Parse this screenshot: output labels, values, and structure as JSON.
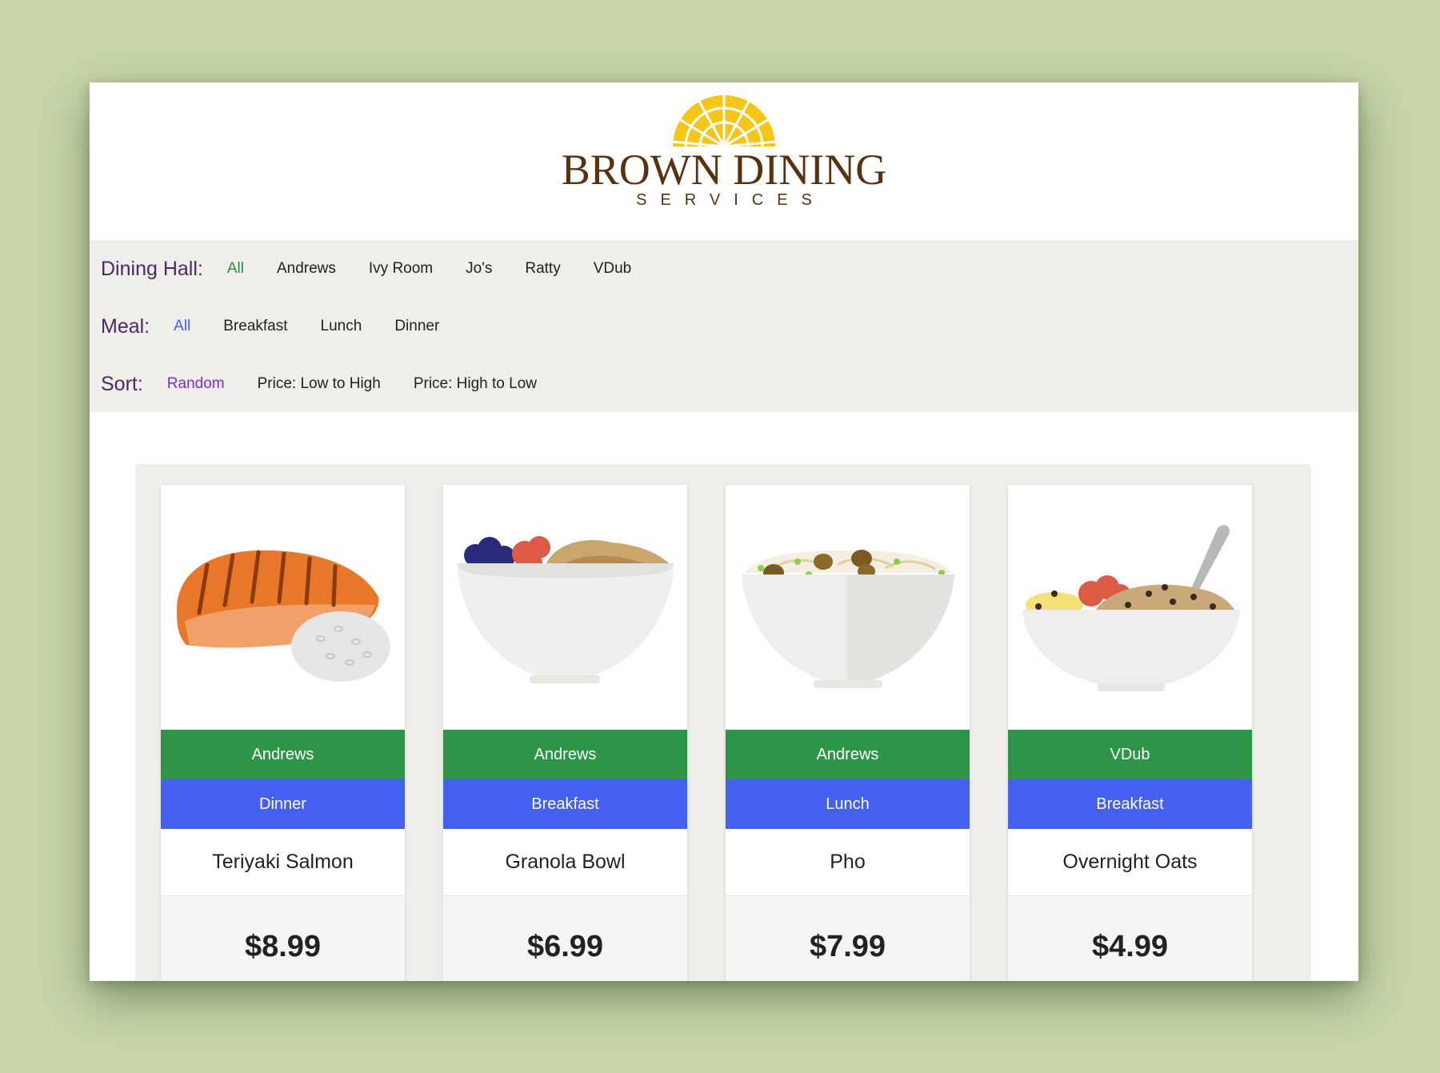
{
  "header": {
    "logo_title": "BROWN DINING",
    "logo_subtitle": "SERVICES"
  },
  "filters": {
    "dining_hall": {
      "label": "Dining Hall:",
      "options": [
        "All",
        "Andrews",
        "Ivy Room",
        "Jo's",
        "Ratty",
        "VDub"
      ],
      "selected": "All"
    },
    "meal": {
      "label": "Meal:",
      "options": [
        "All",
        "Breakfast",
        "Lunch",
        "Dinner"
      ],
      "selected": "All"
    },
    "sort": {
      "label": "Sort:",
      "options": [
        "Random",
        "Price: Low to High",
        "Price: High to Low"
      ],
      "selected": "Random"
    }
  },
  "colors": {
    "background": "#c8d6aa",
    "hall_badge": "#2e9448",
    "meal_badge": "#455ff0",
    "filter_label": "#4a2a63",
    "logo": "#5a3110",
    "logo_sun": "#f5c518"
  },
  "items": [
    {
      "image": "salmon-illustration",
      "hall": "Andrews",
      "meal": "Dinner",
      "name": "Teriyaki Salmon",
      "price": "$8.99"
    },
    {
      "image": "granola-bowl-illustration",
      "hall": "Andrews",
      "meal": "Breakfast",
      "name": "Granola Bowl",
      "price": "$6.99"
    },
    {
      "image": "pho-illustration",
      "hall": "Andrews",
      "meal": "Lunch",
      "name": "Pho",
      "price": "$7.99"
    },
    {
      "image": "oats-illustration",
      "hall": "VDub",
      "meal": "Breakfast",
      "name": "Overnight Oats",
      "price": "$4.99"
    }
  ]
}
